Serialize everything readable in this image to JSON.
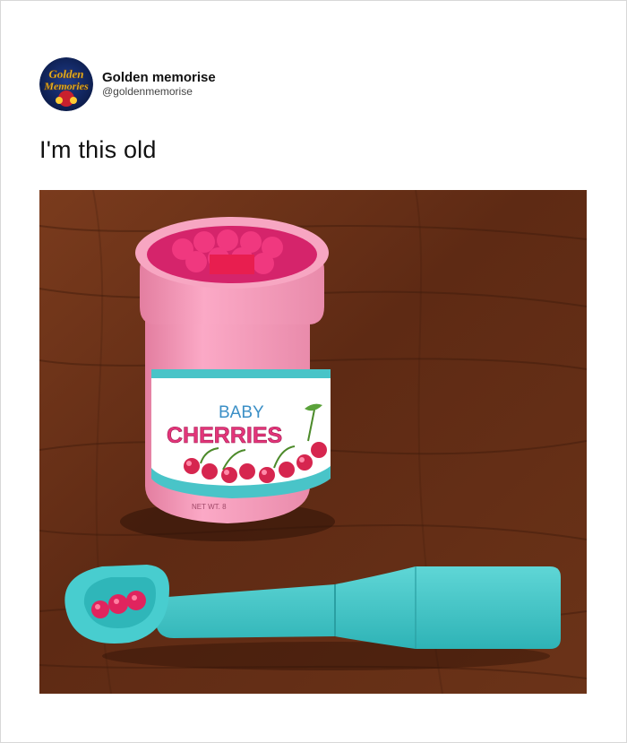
{
  "post": {
    "author_name": "Golden memorise",
    "author_handle": "@goldenmemorise",
    "text": "I'm this old",
    "avatar": {
      "icon": "golden-memories-logo",
      "logo_line1": "Golden",
      "logo_line2": "Memories"
    },
    "photo": {
      "label_line1": "BABY",
      "label_line2": "CHERRIES",
      "net_wt": "NET WT. 8"
    }
  },
  "colors": {
    "wood": "#6b3218",
    "jar_pink": "#f49ab8",
    "cherry": "#e0245e",
    "spoon": "#3fc6c8"
  }
}
